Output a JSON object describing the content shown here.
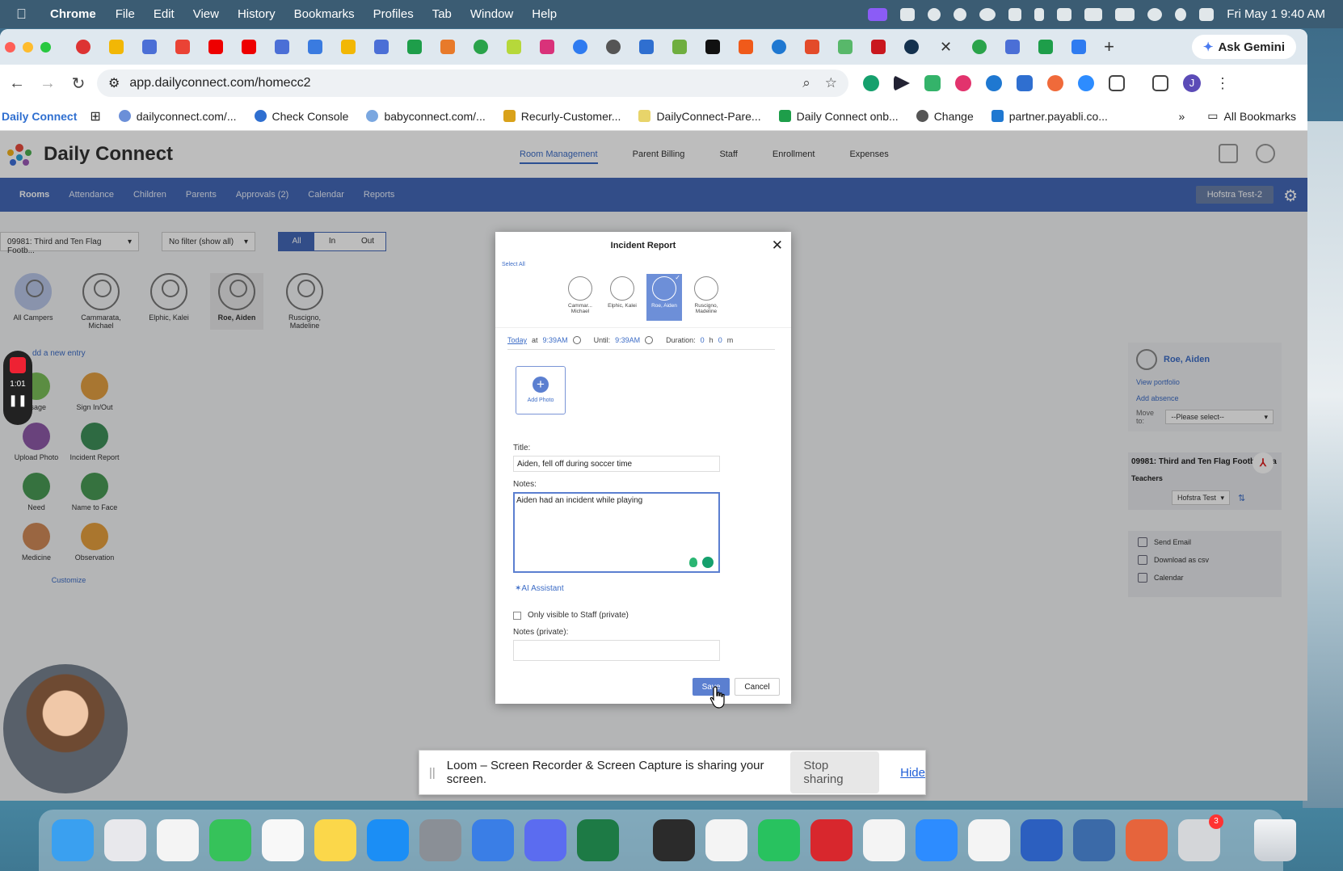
{
  "menubar": {
    "app_name": "Chrome",
    "menus": [
      "File",
      "Edit",
      "View",
      "History",
      "Bookmarks",
      "Profiles",
      "Tab",
      "Window",
      "Help"
    ],
    "clock": "Fri May 1  9:40 AM"
  },
  "browser": {
    "ask_gemini": "Ask Gemini",
    "url": "app.dailyconnect.com/homecc2",
    "profile_initial": "J",
    "bookmarks": [
      "Daily Connect",
      "dailyconnect.com/...",
      "Check Console",
      "babyconnect.com/...",
      "Recurly-Customer...",
      "DailyConnect-Pare...",
      "Daily Connect onb...",
      "Change",
      "partner.payabli.co..."
    ],
    "all_bookmarks": "All Bookmarks"
  },
  "app": {
    "logo": "Daily Connect",
    "top_nav": [
      "Room Management",
      "Parent Billing",
      "Staff",
      "Enrollment",
      "Expenses"
    ],
    "sub_nav": [
      "Rooms",
      "Attendance",
      "Children",
      "Parents",
      "Approvals (2)",
      "Calendar",
      "Reports"
    ],
    "center_name": "Hofstra Test-2",
    "room_filter": "09981: Third and Ten Flag Footb...",
    "status_filter": "No filter (show all)",
    "segments": [
      "All",
      "In",
      "Out"
    ],
    "campers": [
      {
        "name": "All Campers"
      },
      {
        "name": "Cammarata, Michael"
      },
      {
        "name": "Elphic, Kalei"
      },
      {
        "name": "Roe, Aiden"
      },
      {
        "name": "Ruscigno, Madeline"
      }
    ],
    "add_entry": "dd a new entry",
    "actions": [
      {
        "label": "ssage",
        "color": "#7bbf5a"
      },
      {
        "label": "Sign In/Out",
        "color": "#e3a043"
      },
      {
        "label": "Upload Photo",
        "color": "#8e5aa8"
      },
      {
        "label": "Incident Report",
        "color": "#3f8f5a"
      },
      {
        "label": "Need",
        "color": "#4a9a55"
      },
      {
        "label": "Name to Face",
        "color": "#4a9a55"
      },
      {
        "label": "Medicine",
        "color": "#d08a58"
      },
      {
        "label": "Observation",
        "color": "#e6a03f"
      }
    ],
    "customize": "Customize",
    "recorder_time": "1:01",
    "right_panel": {
      "name": "Roe, Aiden",
      "view_portfolio": "View portfolio",
      "add_absence": "Add absence",
      "move_to": "Move to:",
      "move_select": "--Please select--",
      "room_title": "09981: Third and Ten Flag Football Ca",
      "teachers": "Teachers",
      "teacher_select": "Hofstra Test",
      "links": [
        "Send Email",
        "Download as csv",
        "Calendar"
      ]
    }
  },
  "modal": {
    "title": "Incident Report",
    "select_all": "Select All",
    "kids": [
      "Cammar... Michael",
      "Elphic, Kalei",
      "Roe, Aiden",
      "Ruscigno, Madeline"
    ],
    "date": "Today",
    "at": "at",
    "start_time": "9:39AM",
    "until_label": "Until:",
    "end_time": "9:39AM",
    "duration_label": "Duration:",
    "duration_h": "0",
    "h": "h",
    "duration_m": "0",
    "m": "m",
    "add_photo": "Add Photo",
    "title_label": "Title:",
    "title_value": "Aiden, fell off during soccer time",
    "notes_label": "Notes:",
    "notes_value": "Aiden had an incident while playing",
    "ai_assistant": "AI Assistant",
    "private_checkbox": "Only visible to Staff (private)",
    "private_notes_label": "Notes (private):",
    "save": "Save",
    "cancel": "Cancel"
  },
  "loom": {
    "message": "Loom – Screen Recorder & Screen Capture is sharing your screen.",
    "stop": "Stop sharing",
    "hide": "Hide"
  },
  "dock": {
    "apps": [
      {
        "name": "finder-icon",
        "color": "#3aa0f0"
      },
      {
        "name": "launchpad-icon",
        "color": "#e8e8ec"
      },
      {
        "name": "photos-icon",
        "color": "#f4f4f4"
      },
      {
        "name": "numbers-icon",
        "color": "#36c25a"
      },
      {
        "name": "reminders-icon",
        "color": "#f8f8f8"
      },
      {
        "name": "notes-icon",
        "color": "#fbd74a"
      },
      {
        "name": "app-store-icon",
        "color": "#1b8ef5"
      },
      {
        "name": "system-settings-icon",
        "color": "#8a8f96"
      },
      {
        "name": "mirror-icon",
        "color": "#3a7ee6"
      },
      {
        "name": "phone-mirroring-icon",
        "color": "#5b6cf0"
      },
      {
        "name": "excel-icon",
        "color": "#1d7a45"
      },
      {
        "name": "calculator-icon",
        "color": "#2b2b2b"
      },
      {
        "name": "asana-icon",
        "color": "#f4f4f4"
      },
      {
        "name": "whatsapp-icon",
        "color": "#28c25f"
      },
      {
        "name": "acrobat-icon",
        "color": "#d8272d"
      },
      {
        "name": "slack-icon",
        "color": "#f4f4f4"
      },
      {
        "name": "zoom-icon",
        "color": "#2d8cff"
      },
      {
        "name": "chrome-icon",
        "color": "#f4f4f4"
      },
      {
        "name": "word-icon",
        "color": "#2c5fbf"
      },
      {
        "name": "proton-vpn-icon",
        "color": "#3b6aa8"
      },
      {
        "name": "claude-icon",
        "color": "#e6643c"
      },
      {
        "name": "printer-icon",
        "color": "#d4d6d9"
      }
    ],
    "printer_badge": "3",
    "trash": "trash-icon"
  }
}
